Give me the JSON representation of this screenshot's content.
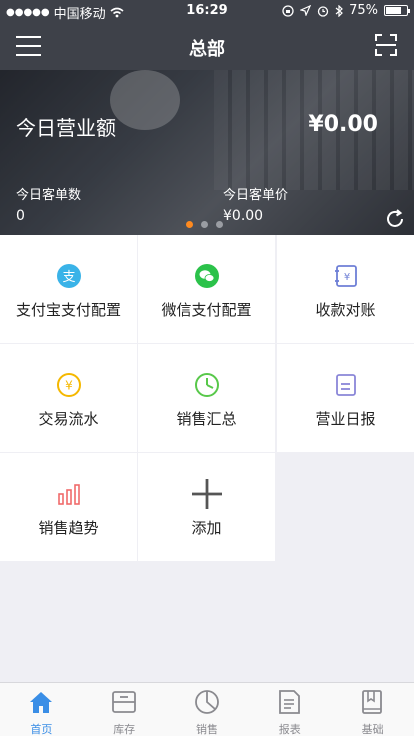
{
  "status_bar": {
    "carrier": "中国移动",
    "time": "16:29",
    "battery_text": "75%",
    "battery_level": 0.75
  },
  "nav": {
    "title": "总部"
  },
  "banner": {
    "revenue_label": "今日营业额",
    "revenue_value": "¥0.00",
    "customers_label": "今日客单数",
    "customers_value": "0",
    "avg_price_label": "今日客单价",
    "avg_price_value": "¥0.00",
    "pages": 3,
    "active_page": 1
  },
  "grid": {
    "items": [
      {
        "label": "支付宝支付配置",
        "icon": "alipay-icon",
        "color": "#3ab3e8"
      },
      {
        "label": "微信支付配置",
        "icon": "wechat-icon",
        "color": "#2bc24a"
      },
      {
        "label": "收款对账",
        "icon": "receipt-icon",
        "color": "#6e7fd6"
      },
      {
        "label": "交易流水",
        "icon": "coin-icon",
        "color": "#f5b800"
      },
      {
        "label": "销售汇总",
        "icon": "pie-clock-icon",
        "color": "#58c84a"
      },
      {
        "label": "营业日报",
        "icon": "report-icon",
        "color": "#8a86d8"
      },
      {
        "label": "销售趋势",
        "icon": "bar-chart-icon",
        "color": "#f06a6a"
      },
      {
        "label": "添加",
        "icon": "plus-icon",
        "color": "#555555"
      }
    ]
  },
  "tabbar": {
    "items": [
      {
        "label": "首页",
        "icon": "home-icon",
        "active": true
      },
      {
        "label": "库存",
        "icon": "inventory-icon",
        "active": false
      },
      {
        "label": "销售",
        "icon": "sales-pie-icon",
        "active": false
      },
      {
        "label": "报表",
        "icon": "report-doc-icon",
        "active": false
      },
      {
        "label": "基础",
        "icon": "book-icon",
        "active": false
      }
    ],
    "active_color": "#3a8ee6",
    "inactive_color": "#8a8a8f"
  }
}
